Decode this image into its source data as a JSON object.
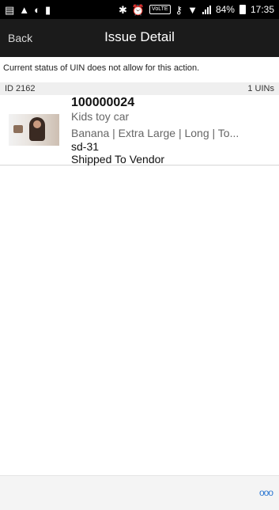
{
  "status_bar": {
    "battery_percent": "84%",
    "time": "17:35",
    "icons": [
      "message-icon",
      "warning-icon",
      "circle-icon",
      "notification-icon",
      "bluetooth-icon",
      "alarm-icon",
      "volte-icon",
      "key-icon",
      "wifi-icon",
      "signal-icon",
      "battery-icon"
    ],
    "volte_label": "VoLTE"
  },
  "header": {
    "back_label": "Back",
    "title": "Issue Detail"
  },
  "message": "Current status of UIN does not allow for this action.",
  "info": {
    "id_label": "ID 2162",
    "uins_label": "1 UINs"
  },
  "item": {
    "uin": "100000024",
    "product": "Kids toy car",
    "attributes": "Banana | Extra Large | Long | To...",
    "code": "sd-31",
    "status": "Shipped To Vendor"
  },
  "footer": {
    "more_label": "ooo"
  }
}
